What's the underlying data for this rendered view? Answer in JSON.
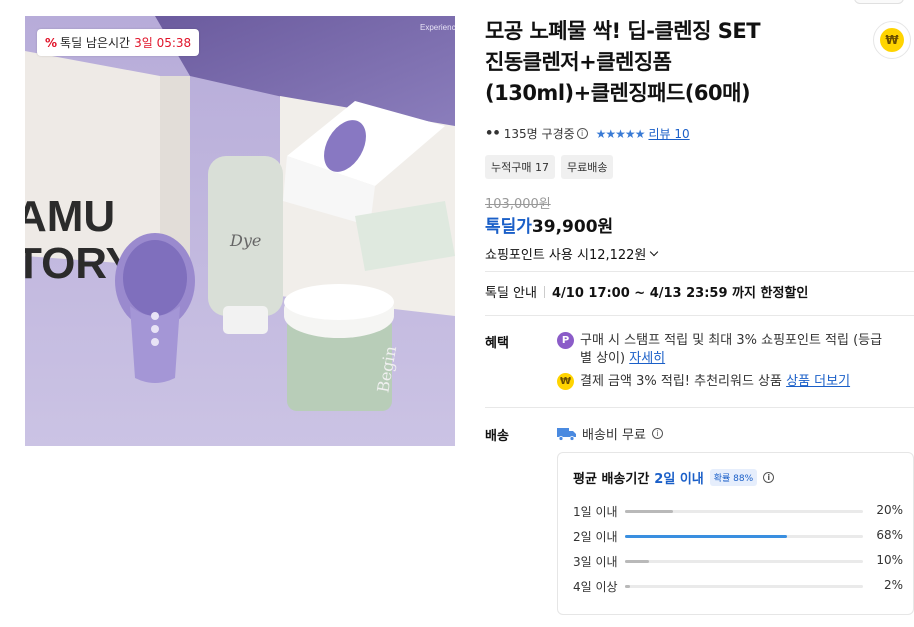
{
  "product": {
    "timer_label": "톡딜 남은시간",
    "timer_value": "3일 05:38",
    "title_line1": "모공 노폐물 싹! 딥-클렌징 SET",
    "title_line2": "진동클렌저+클렌징폼",
    "title_line3": "(130ml)+클렌징패드(60매)",
    "purchasers": "135명 구경중",
    "stars": "★★★★★",
    "review_link": "리뷰 10",
    "tags": [
      "누적구매 17",
      "무료배송"
    ],
    "original_price": "103,000원",
    "deal_label": "톡딜가",
    "deal_price": "39,900원",
    "points_text": "쇼핑포인트 사용 시12,122원",
    "deal_info_label": "톡딜 안내",
    "deal_info_value": "4/10 17:00 ~ 4/13 23:59 까지 한정할인"
  },
  "image_text": {
    "brand": "NAMU STORY",
    "box_corner": "Experience a",
    "tube_logo": "Dye",
    "jar_logo": "Begin"
  },
  "benefits": {
    "label": "혜택",
    "item1_text": "구매 시 스탬프 적립 및 최대 3% 쇼핑포인트 적립 (등급별 상이)",
    "item1_link": "자세히",
    "item2_text": "결제 금액 3% 적립! 추천리워드 상품",
    "item2_link": "상품 더보기"
  },
  "shipping": {
    "label": "배송",
    "fee_text": "배송비 무료",
    "avg_label": "평균 배송기간",
    "avg_value": "2일 이내",
    "rate_chip": "확률 88%",
    "distribution": [
      {
        "label": "1일 이내",
        "percent": "20%",
        "value": 20,
        "color": "#b9b9b9"
      },
      {
        "label": "2일 이내",
        "percent": "68%",
        "value": 68,
        "color": "#3a8fe0"
      },
      {
        "label": "3일 이내",
        "percent": "10%",
        "value": 10,
        "color": "#b9b9b9"
      },
      {
        "label": "4일 이상",
        "percent": "2%",
        "value": 2,
        "color": "#b9b9b9"
      }
    ]
  },
  "icons": {
    "won_coin": "₩",
    "points_badge": "P",
    "info_glyph": "i",
    "discount_glyph": "%"
  }
}
